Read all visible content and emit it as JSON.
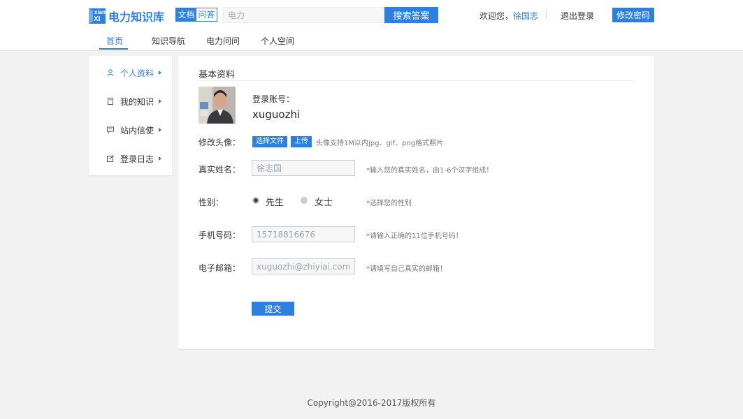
{
  "brand": {
    "logo_letters_top": "xian",
    "logo_letters_bottom": "XI",
    "name": "电力知识库"
  },
  "search": {
    "type_doc": "文档",
    "type_qa": "问答",
    "placeholder": "电力",
    "button": "搜索答案"
  },
  "user": {
    "welcome": "欢迎您，",
    "name": "徐国志",
    "logout": "退出登录",
    "change_password": "修改密码"
  },
  "nav": {
    "items": [
      "首页",
      "知识导航",
      "电力问问",
      "个人空间"
    ],
    "active": "首页"
  },
  "sidebar": {
    "items": [
      {
        "label": "个人资料",
        "icon": "user-icon"
      },
      {
        "label": "我的知识",
        "icon": "document-icon"
      },
      {
        "label": "站内信使",
        "icon": "message-icon"
      },
      {
        "label": "登录日志",
        "icon": "edit-icon"
      }
    ],
    "active": "个人资料"
  },
  "profile": {
    "section_title": "基本资料",
    "account_label": "登录账号：",
    "account_value": "xuguozhi",
    "avatar_label": "修改头像：",
    "choose_file": "选择文件",
    "upload": "上传",
    "avatar_hint": "头像支持1M以内jpg、gif、png格式照片",
    "realname_label": "真实姓名：",
    "realname_placeholder": "徐志国",
    "realname_hint": "*输入您的真实姓名，由1-6个汉字组成！",
    "gender_label": "性别：",
    "gender_options": [
      "先生",
      "女士"
    ],
    "gender_selected": "先生",
    "gender_hint": "*选择您的性别",
    "phone_label": "手机号码：",
    "phone_placeholder": "15718816676",
    "phone_hint": "*请输入正确的11位手机号码！",
    "email_label": "电子邮箱：",
    "email_placeholder": "xuguozhi@zhiyiai.com",
    "email_hint": "*请填写自己真实的邮箱！",
    "submit": "提交"
  },
  "footer": {
    "copyright": "Copyright@2016-2017版权所有"
  },
  "colors": {
    "primary": "#2d7fe0",
    "background": "#f2f2f2"
  }
}
